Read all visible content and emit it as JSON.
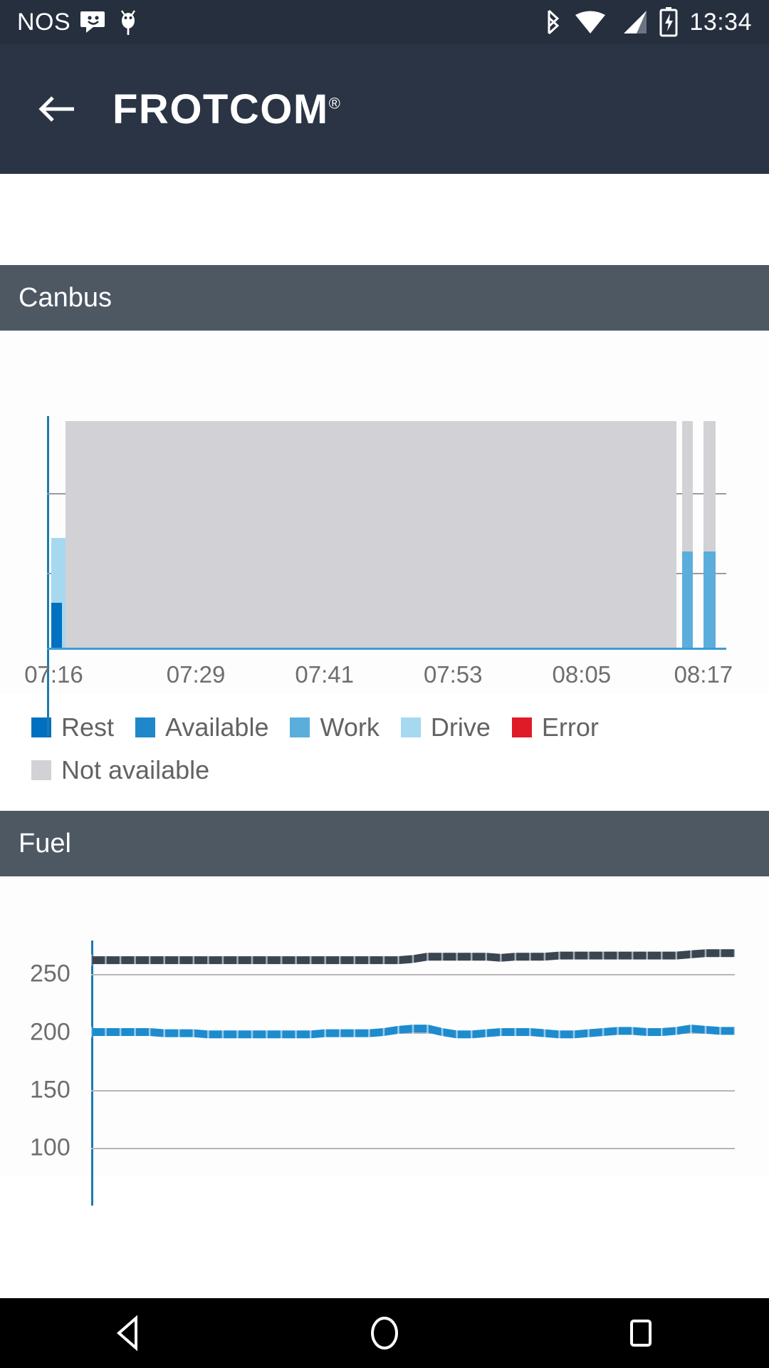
{
  "statusbar": {
    "carrier": "NOS",
    "time": "13:34",
    "icons": [
      "message-smiley-icon",
      "android-debug-bug-icon",
      "bluetooth-icon",
      "wifi-icon",
      "cellular-signal-icon",
      "battery-charging-icon"
    ]
  },
  "appbar": {
    "back_icon": "arrow-left-icon",
    "brand": "FROTCOM",
    "brand_mark": "®",
    "bg_color": "#2a3444"
  },
  "sections": [
    {
      "id": "canbus",
      "title": "Canbus"
    },
    {
      "id": "fuel",
      "title": "Fuel"
    }
  ],
  "navbar": {
    "back_label": "back-button",
    "home_label": "home-button",
    "recents_label": "recents-button"
  },
  "colors": {
    "status_bar": "#252f3d",
    "app_bar": "#2a3444",
    "section_header": "#4d5863",
    "axis": "#1b7bb0",
    "rest": "#0070c0",
    "available": "#1e88cb",
    "work": "#5baedc",
    "drive": "#a6d8ef",
    "error": "#e01b28",
    "not_available": "#d2d2d6",
    "fuel_series_1": "#3a4552",
    "fuel_series_2": "#1e8bce"
  },
  "chart_data": [
    {
      "id": "canbus",
      "type": "bar",
      "title": "Canbus",
      "xlabel": "",
      "ylabel": "",
      "grid": true,
      "legend_position": "below",
      "xtick_labels": [
        "07:16",
        "07:29",
        "07:41",
        "07:53",
        "08:05",
        "08:17"
      ],
      "xtick_positions_pct": [
        1,
        22,
        41,
        60,
        79,
        97
      ],
      "gridlines_pct": [
        33,
        67
      ],
      "legend": [
        {
          "label": "Rest",
          "color": "#0070c0"
        },
        {
          "label": "Available",
          "color": "#1e88cb"
        },
        {
          "label": "Work",
          "color": "#5baedc"
        },
        {
          "label": "Drive",
          "color": "#a6d8ef"
        },
        {
          "label": "Error",
          "color": "#e01b28"
        },
        {
          "label": "Not available",
          "color": "#d2d2d6"
        }
      ],
      "bars": [
        {
          "series": "Drive",
          "color": "#a6d8ef",
          "left_pct": 0.6,
          "width_pct": 2.1,
          "height_pct": 48
        },
        {
          "series": "Rest",
          "color": "#0070c0",
          "left_pct": 0.6,
          "width_pct": 1.6,
          "height_pct": 20
        },
        {
          "series": "Not available",
          "color": "#d2d2d6",
          "left_pct": 2.7,
          "width_pct": 90.0,
          "height_pct": 98
        },
        {
          "series": "Not available",
          "color": "#d2d2d6",
          "left_pct": 93.5,
          "width_pct": 1.6,
          "height_pct": 98
        },
        {
          "series": "Work",
          "color": "#5baedc",
          "left_pct": 93.5,
          "width_pct": 1.6,
          "height_pct": 42
        },
        {
          "series": "Not available",
          "color": "#d2d2d6",
          "left_pct": 96.6,
          "width_pct": 1.8,
          "height_pct": 98
        },
        {
          "series": "Work",
          "color": "#5baedc",
          "left_pct": 96.6,
          "width_pct": 1.8,
          "height_pct": 42
        }
      ]
    },
    {
      "id": "fuel",
      "type": "line",
      "title": "Fuel",
      "xlabel": "",
      "ylabel": "",
      "grid": true,
      "ylim": [
        75,
        290
      ],
      "ytick_labels": [
        "250",
        "200",
        "150",
        "100"
      ],
      "ytick_values": [
        250,
        200,
        150,
        100
      ],
      "series": [
        {
          "name": "fuel-series-upper",
          "color": "#3a4552",
          "values": [
            262,
            262,
            262,
            262,
            262,
            262,
            262,
            262,
            262,
            262,
            262,
            262,
            262,
            262,
            262,
            262,
            262,
            262,
            262,
            262,
            262,
            262,
            263,
            265,
            265,
            265,
            265,
            265,
            264,
            265,
            265,
            265,
            266,
            266,
            266,
            266,
            266,
            266,
            266,
            266,
            266,
            267,
            268,
            268,
            268
          ]
        },
        {
          "name": "fuel-series-lower",
          "color": "#1e8bce",
          "values": [
            200,
            200,
            200,
            200,
            200,
            199,
            199,
            199,
            198,
            198,
            198,
            198,
            198,
            198,
            198,
            198,
            199,
            199,
            199,
            199,
            200,
            202,
            203,
            203,
            200,
            198,
            198,
            199,
            200,
            200,
            200,
            199,
            198,
            198,
            199,
            200,
            201,
            201,
            200,
            200,
            201,
            203,
            202,
            201,
            201
          ]
        }
      ]
    }
  ]
}
